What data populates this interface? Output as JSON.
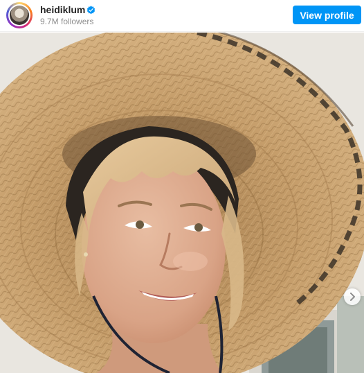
{
  "profile": {
    "username": "heidiklum",
    "followers": "9.7M followers",
    "verified": true
  },
  "actions": {
    "view_profile_label": "View profile"
  },
  "post": {
    "image_subject": "woman-in-straw-hat-selfie",
    "carousel_next_icon": "chevron-right-icon"
  },
  "colors": {
    "accent": "#0095f6",
    "verified_badge": "#0095f6",
    "username_text": "#262626",
    "secondary_text": "#8e8e8e",
    "story_ring": "#d62976"
  }
}
